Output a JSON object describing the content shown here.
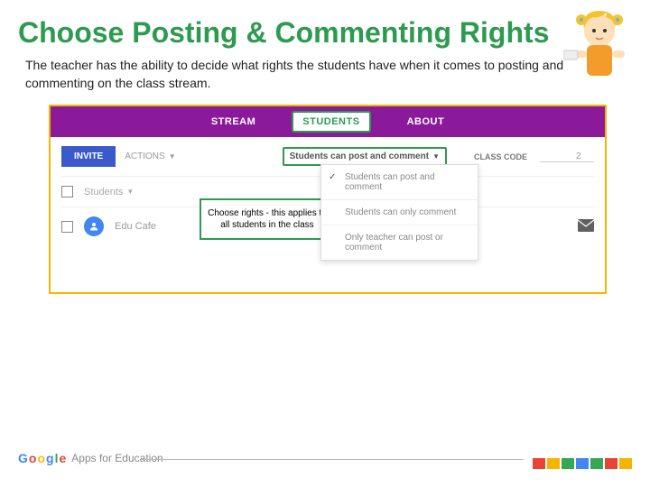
{
  "title": "Choose Posting & Commenting Rights",
  "description": "The teacher has the ability to decide what rights the students have when it comes to posting and commenting on the class stream.",
  "tabs": {
    "stream": "STREAM",
    "students": "STUDENTS",
    "about": "ABOUT"
  },
  "toolbar": {
    "invite": "INVITE",
    "actions": "ACTIONS",
    "perm_selected": "Students can post and comment",
    "classcode_label": "CLASS CODE",
    "classcode_value": "2"
  },
  "dropdown": {
    "opt1": "Students can post and comment",
    "opt2": "Students can only comment",
    "opt3": "Only teacher can post or comment"
  },
  "callout": "Choose rights - this applies to all students in the class",
  "rows": {
    "header": "Students",
    "student1": "Edu Cafe"
  },
  "footer": {
    "brand": "Apps for Education"
  }
}
